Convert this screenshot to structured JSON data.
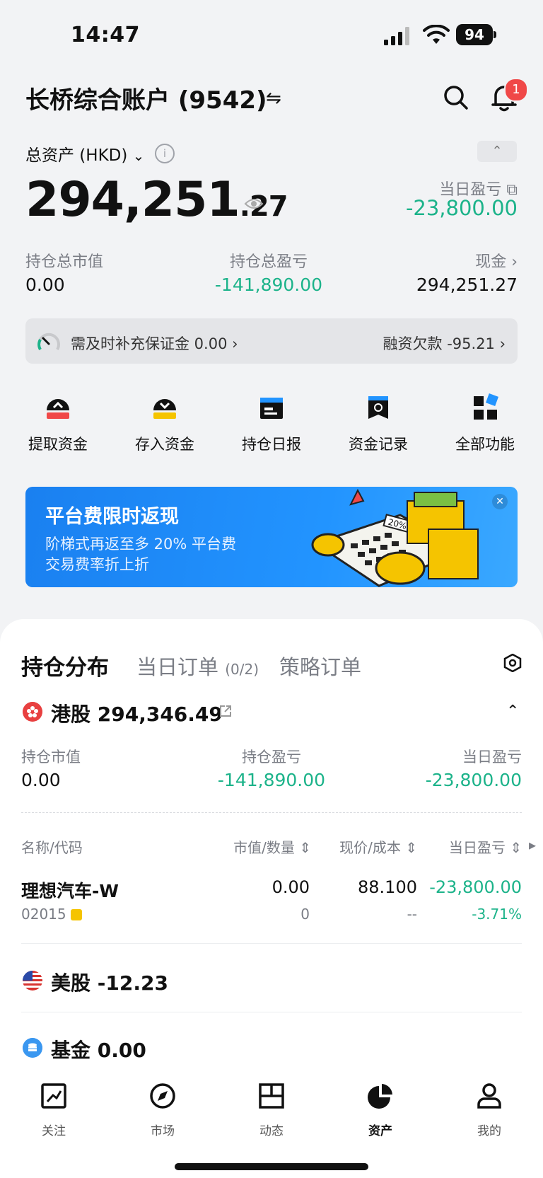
{
  "status": {
    "time": "14:47",
    "battery": "94"
  },
  "header": {
    "account_title": "长桥综合账户 (9542)",
    "notification_count": "1",
    "total_label": "总资产 (HKD)",
    "total_int": "294,251",
    "total_dec": ".27",
    "day_pl_label": "当日盈亏",
    "day_pl_value": "-23,800.00"
  },
  "stats": [
    {
      "label": "持仓总市值",
      "value": "0.00"
    },
    {
      "label": "持仓总盈亏",
      "value": "-141,890.00"
    },
    {
      "label": "现金 ›",
      "value": "294,251.27"
    }
  ],
  "margin": {
    "text": "需及时补充保证金 0.00 ›",
    "loan": "融资欠款 -95.21 ›"
  },
  "quick_actions": [
    {
      "label": "提取资金",
      "icon": "withdraw-icon"
    },
    {
      "label": "存入资金",
      "icon": "deposit-icon"
    },
    {
      "label": "持仓日报",
      "icon": "daily-report-icon"
    },
    {
      "label": "资金记录",
      "icon": "fund-records-icon"
    },
    {
      "label": "全部功能",
      "icon": "all-functions-icon"
    }
  ],
  "banner": {
    "title": "平台费限时返现",
    "line1": "阶梯式再返至多 20% 平台费",
    "line2": "交易费率折上折",
    "calc_label": "20%"
  },
  "tabs": {
    "active": "持仓分布",
    "orders": "当日订单",
    "orders_count": "(0/2)",
    "strategy": "策略订单"
  },
  "hk": {
    "title": "港股 294,346.49",
    "labels": [
      "持仓市值",
      "持仓盈亏",
      "当日盈亏"
    ],
    "values": [
      "0.00",
      "-141,890.00",
      "-23,800.00"
    ]
  },
  "table": {
    "headers": [
      "名称/代码",
      "市值/数量 ⇕",
      "现价/成本 ⇕",
      "当日盈亏 ⇕"
    ],
    "rows": [
      {
        "name": "理想汽车-W",
        "code": "02015",
        "market_value": "0.00",
        "qty": "0",
        "price": "88.100",
        "cost": "--",
        "day_pl": "-23,800.00",
        "day_pl_pct": "-3.71%"
      }
    ]
  },
  "us": {
    "title": "美股 -12.23"
  },
  "fund": {
    "title": "基金 0.00"
  },
  "nav": [
    {
      "label": "关注",
      "icon": "watchlist-icon"
    },
    {
      "label": "市场",
      "icon": "market-icon"
    },
    {
      "label": "动态",
      "icon": "feed-icon"
    },
    {
      "label": "资产",
      "icon": "assets-icon"
    },
    {
      "label": "我的",
      "icon": "profile-icon"
    }
  ],
  "colors": {
    "green": "#1cb38a",
    "accent_blue": "#2294ff",
    "badge_red": "#f04848"
  }
}
